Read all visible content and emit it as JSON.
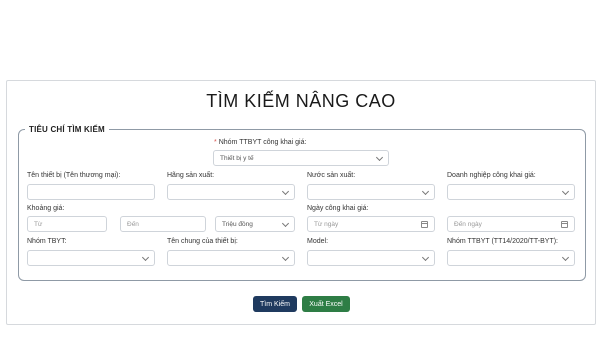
{
  "title": "TÌM KIẾM NÂNG CAO",
  "legend": "TIÊU CHÍ TÌM KIẾM",
  "required_marker": "*",
  "group": {
    "label": "Nhóm TTBYT công khai giá:",
    "value": "Thiết bị y tế"
  },
  "fields": {
    "device_name": {
      "label": "Tên thiết bị (Tên thương mại):"
    },
    "manufacturer": {
      "label": "Hãng sản xuất:"
    },
    "country": {
      "label": "Nước sản xuất:"
    },
    "company": {
      "label": "Doanh nghiệp công khai giá:"
    },
    "price_range": {
      "label": "Khoảng giá:",
      "from_placeholder": "Từ",
      "to_placeholder": "Đến",
      "unit": "Triệu đồng"
    },
    "publish_date": {
      "label": "Ngày công khai giá:",
      "from_placeholder": "Từ ngày",
      "to_placeholder": "Đến ngày"
    },
    "tbyt_group": {
      "label": "Nhóm TBYT:"
    },
    "common_name": {
      "label": "Tên chung của thiết bị:"
    },
    "model": {
      "label": "Model:"
    },
    "tt14_group": {
      "label": "Nhóm TTBYT (TT14/2020/TT-BYT):"
    }
  },
  "buttons": {
    "search": "Tìm Kiếm",
    "export": "Xuất Excel"
  },
  "colors": {
    "search_button": "#1f3a5f",
    "export_button": "#2e7d45",
    "required": "#d9534f"
  }
}
